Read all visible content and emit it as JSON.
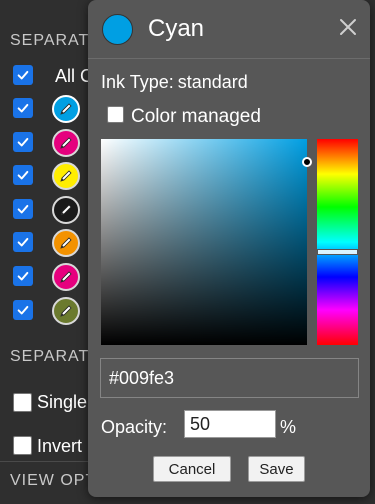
{
  "background": {
    "separations_heading": "SEPARATIONS",
    "all_label": "All Colors",
    "plates": [
      {
        "icon": "pencil-icon",
        "color": "#009fe3",
        "checked": true,
        "selected": true
      },
      {
        "icon": "pencil-icon",
        "color": "#e5007e",
        "checked": true
      },
      {
        "icon": "pencil-icon",
        "color": "#ffed00",
        "checked": true
      },
      {
        "icon": "pencil-icon",
        "color": "#1a1a1a",
        "checked": true
      },
      {
        "icon": "pencil-icon",
        "color": "#f39200",
        "checked": true
      },
      {
        "icon": "pencil-icon",
        "color": "#e6007e",
        "checked": true
      },
      {
        "icon": "pencil-icon",
        "color": "#6b7a2e",
        "checked": true
      }
    ],
    "options_heading": "SEPARATION OPTIONS",
    "single_label": "Single",
    "invert_label": "Invert",
    "view_heading": "VIEW OPTIONS"
  },
  "picker": {
    "title": "Cyan",
    "swatch_color": "#009fe3",
    "ink_type_label": "Ink Type:",
    "ink_type_value": "standard",
    "color_managed_label": "Color managed",
    "color_managed_checked": false,
    "hex_value": "#009fe3",
    "opacity_label": "Opacity:",
    "opacity_value": "50",
    "opacity_unit": "%",
    "cancel_label": "Cancel",
    "save_label": "Save",
    "saturation": 1.0,
    "brightness": 0.89,
    "hue": 197,
    "close_icon": "close-icon"
  }
}
